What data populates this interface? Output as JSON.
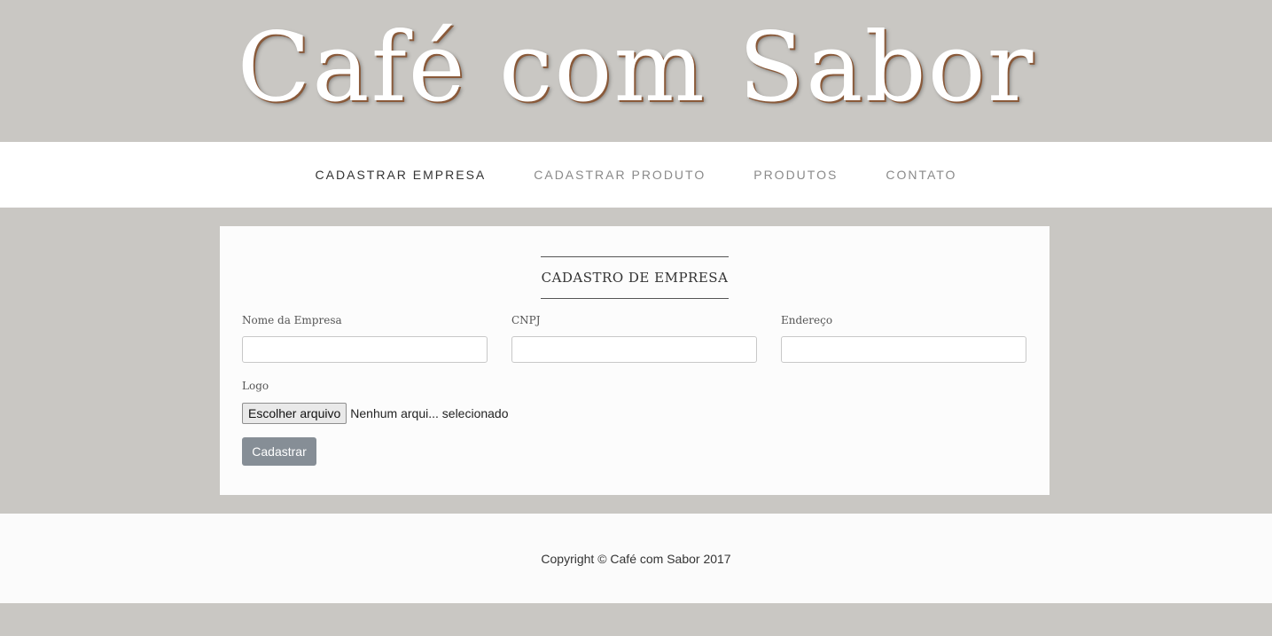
{
  "header": {
    "site_title": "Café com Sabor"
  },
  "nav": {
    "items": [
      {
        "label": "CADASTRAR EMPRESA",
        "active": true
      },
      {
        "label": "CADASTRAR PRODUTO",
        "active": false
      },
      {
        "label": "PRODUTOS",
        "active": false
      },
      {
        "label": "CONTATO",
        "active": false
      }
    ]
  },
  "form": {
    "title": "CADASTRO DE EMPRESA",
    "fields": {
      "company_name": {
        "label": "Nome da Empresa",
        "value": ""
      },
      "cnpj": {
        "label": "CNPJ",
        "value": ""
      },
      "address": {
        "label": "Endereço",
        "value": ""
      }
    },
    "logo": {
      "label": "Logo",
      "button_label": "Escolher arquivo",
      "status": "Nenhum arqui... selecionado"
    },
    "submit_label": "Cadastrar"
  },
  "footer": {
    "copyright": "Copyright © Café com Sabor 2017"
  },
  "colors": {
    "background": "#c9c7c3",
    "panel": "#fcfcfc",
    "button": "#868e96",
    "title_shadow": "#8a5a3a"
  }
}
